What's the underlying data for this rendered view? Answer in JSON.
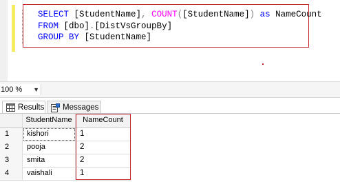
{
  "editor": {
    "sql_lines": [
      [
        {
          "text": "SELECT ",
          "style": "kw"
        },
        {
          "text": "[StudentName]",
          "style": "tx"
        },
        {
          "text": ", ",
          "style": "gr"
        },
        {
          "text": "COUNT",
          "style": "fn"
        },
        {
          "text": "(",
          "style": "gr"
        },
        {
          "text": "[StudentName]",
          "style": "tx"
        },
        {
          "text": ") ",
          "style": "gr"
        },
        {
          "text": "as ",
          "style": "kw"
        },
        {
          "text": "NameCount",
          "style": "tx"
        }
      ],
      [
        {
          "text": "FROM ",
          "style": "kw"
        },
        {
          "text": "[dbo]",
          "style": "tx"
        },
        {
          "text": ".",
          "style": "gr"
        },
        {
          "text": "[DistVsGroupBy]",
          "style": "tx"
        }
      ],
      [
        {
          "text": "GROUP BY ",
          "style": "kw"
        },
        {
          "text": "[StudentName]",
          "style": "tx"
        }
      ]
    ]
  },
  "zoom": {
    "value": "100 %"
  },
  "tabs": {
    "results_label": "Results",
    "messages_label": "Messages"
  },
  "grid": {
    "headers": [
      "StudentName",
      "NameCount"
    ],
    "rows": [
      {
        "num": "1",
        "name": "kishori",
        "count": "1"
      },
      {
        "num": "2",
        "name": "pooja",
        "count": "2"
      },
      {
        "num": "3",
        "name": "smita",
        "count": "2"
      },
      {
        "num": "4",
        "name": "vaishali",
        "count": "1"
      }
    ]
  },
  "colors": {
    "highlight_border": "#c2262e",
    "keyword": "#0000ff",
    "function": "#ff00ff"
  }
}
